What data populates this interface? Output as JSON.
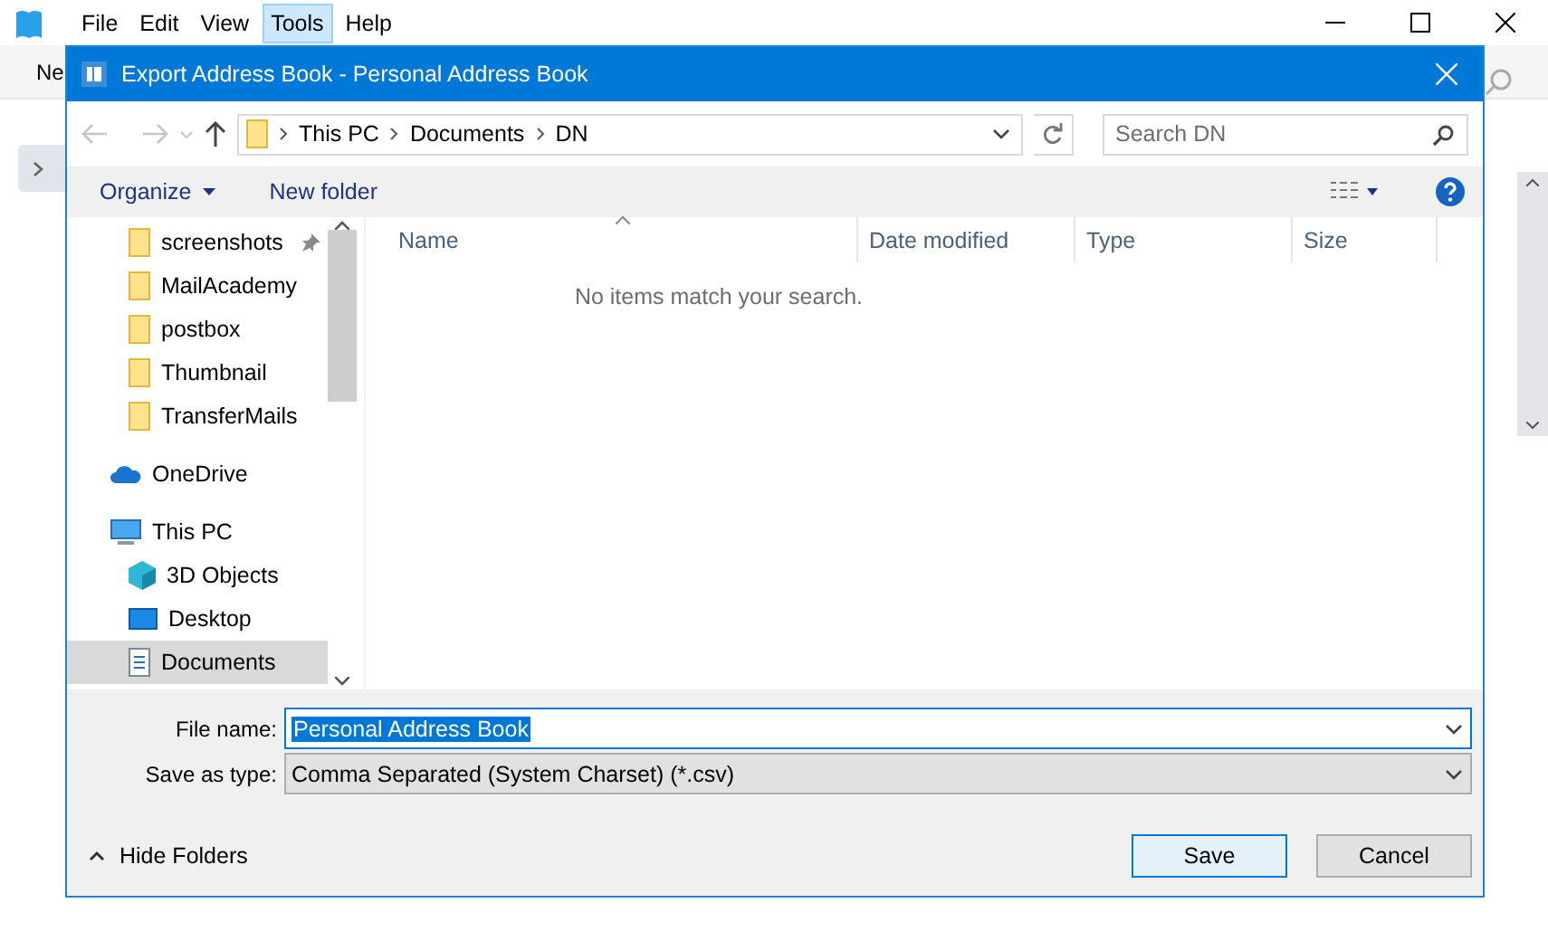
{
  "app": {
    "menu": [
      {
        "label": "File",
        "selected": false
      },
      {
        "label": "Edit",
        "selected": false
      },
      {
        "label": "View",
        "selected": false
      },
      {
        "label": "Tools",
        "selected": true
      },
      {
        "label": "Help",
        "selected": false
      }
    ],
    "toolbar_text": "Ne"
  },
  "dialog": {
    "title": "Export Address Book - Personal Address Book",
    "breadcrumb": [
      "This PC",
      "Documents",
      "DN"
    ],
    "search": {
      "placeholder": "Search DN"
    },
    "toolbar": {
      "organize": "Organize",
      "new_folder": "New folder"
    },
    "nav": [
      {
        "label": "screenshots",
        "kind": "folder",
        "pinned": true,
        "selected": false
      },
      {
        "label": "MailAcademy",
        "kind": "folder",
        "pinned": false,
        "selected": false
      },
      {
        "label": "postbox",
        "kind": "folder",
        "pinned": false,
        "selected": false
      },
      {
        "label": "Thumbnail",
        "kind": "folder",
        "pinned": false,
        "selected": false
      },
      {
        "label": "TransferMails",
        "kind": "folder",
        "pinned": false,
        "selected": false
      },
      {
        "label": "OneDrive",
        "kind": "cloud",
        "pinned": false,
        "selected": false
      },
      {
        "label": "This PC",
        "kind": "pc",
        "pinned": false,
        "selected": false,
        "children": [
          {
            "label": "3D Objects",
            "kind": "cube",
            "pinned": false,
            "selected": false
          },
          {
            "label": "Desktop",
            "kind": "desktop",
            "pinned": false,
            "selected": false
          },
          {
            "label": "Documents",
            "kind": "document",
            "pinned": false,
            "selected": true
          }
        ]
      }
    ],
    "columns": [
      "Name",
      "Date modified",
      "Type",
      "Size"
    ],
    "empty_message": "No items match your search.",
    "file_name": {
      "label": "File name:",
      "value": "Personal Address Book"
    },
    "save_type": {
      "label": "Save as type:",
      "value": "Comma Separated (System Charset) (*.csv)"
    },
    "hide_folders": "Hide Folders",
    "buttons": [
      {
        "label": "Save",
        "default": true
      },
      {
        "label": "Cancel",
        "default": false
      }
    ]
  }
}
